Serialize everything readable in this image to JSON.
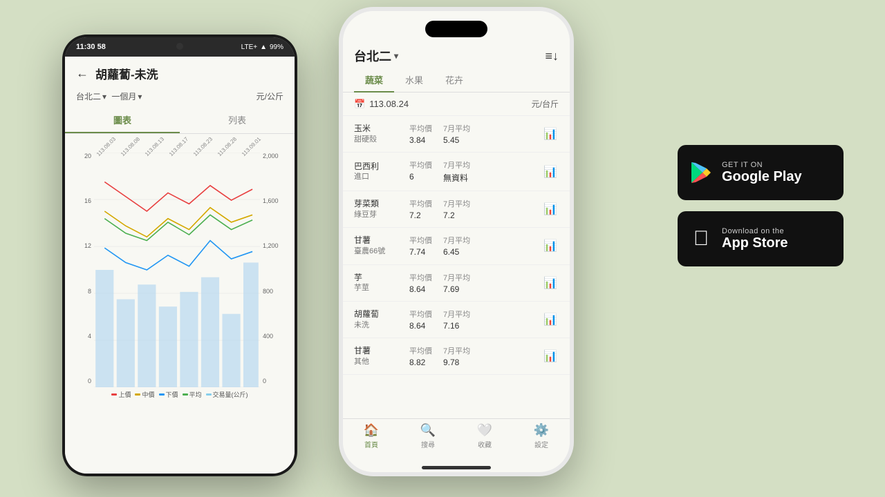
{
  "background_color": "#d4dfc4",
  "android_phone": {
    "status_time": "11:30",
    "status_num": "58",
    "status_signal": "LTE+",
    "status_battery": "99%",
    "header_title": "胡蘿蔔-未洗",
    "location": "台北二",
    "period": "一個月",
    "unit": "元/公斤",
    "tabs": [
      "圖表",
      "列表"
    ],
    "active_tab": 0,
    "chart_dates": [
      "113.08.03",
      "113.08.08",
      "113.08.13",
      "113.08.17",
      "113.08.23",
      "113.08.28",
      "113.09.01"
    ],
    "y_axis_left": [
      "20",
      "16",
      "12",
      "8",
      "4",
      "0"
    ],
    "y_axis_right": [
      "2,000",
      "1,600",
      "1,200",
      "800",
      "400",
      "0"
    ],
    "legend": [
      {
        "label": "上價",
        "color": "#e84040"
      },
      {
        "label": "中價",
        "color": "#d4a800"
      },
      {
        "label": "下價",
        "color": "#2196F3"
      },
      {
        "label": "平均",
        "color": "#4caf50"
      },
      {
        "label": "交易量(公斤)",
        "color": "#87ceeb"
      }
    ]
  },
  "iphone": {
    "market_name": "台北二",
    "tabs": [
      "蔬菜",
      "水果",
      "花卉"
    ],
    "active_tab": 0,
    "date": "113.08.24",
    "unit": "元/台斤",
    "products": [
      {
        "name": "玉米",
        "sub": "甜硬殼",
        "avg": "3.84",
        "avg_label": "平均價",
        "monthly_avg": "5.45",
        "monthly_label": "7月平均"
      },
      {
        "name": "巴西利",
        "sub": "進口",
        "avg": "6",
        "avg_label": "平均價",
        "monthly_avg": "無資料",
        "monthly_label": "7月平均"
      },
      {
        "name": "芽菜類",
        "sub": "綠豆芽",
        "avg": "7.2",
        "avg_label": "平均價",
        "monthly_avg": "7.2",
        "monthly_label": "7月平均"
      },
      {
        "name": "甘薯",
        "sub": "臺農66號",
        "avg": "7.74",
        "avg_label": "平均價",
        "monthly_avg": "6.45",
        "monthly_label": "7月平均"
      },
      {
        "name": "芋",
        "sub": "芋莖",
        "avg": "8.64",
        "avg_label": "平均價",
        "monthly_avg": "7.69",
        "monthly_label": "7月平均"
      },
      {
        "name": "胡蘿蔔",
        "sub": "未洗",
        "avg": "8.64",
        "avg_label": "平均價",
        "monthly_avg": "7.16",
        "monthly_label": "7月平均"
      },
      {
        "name": "甘薯",
        "sub": "其他",
        "avg": "8.82",
        "avg_label": "平均價",
        "monthly_avg": "9.78",
        "monthly_label": "7月平均"
      }
    ],
    "bottom_nav": [
      {
        "label": "首頁",
        "icon": "🏠",
        "active": true
      },
      {
        "label": "搜尋",
        "icon": "🔍",
        "active": false
      },
      {
        "label": "收藏",
        "icon": "🤍",
        "active": false
      },
      {
        "label": "設定",
        "icon": "⚙️",
        "active": false
      }
    ]
  },
  "badges": {
    "google_play": {
      "top": "GET IT ON",
      "bottom": "Google Play"
    },
    "app_store": {
      "top": "Download on the",
      "bottom": "App Store"
    }
  }
}
